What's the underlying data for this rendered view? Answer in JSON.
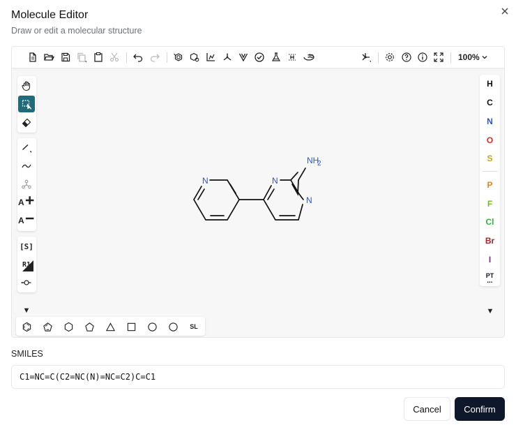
{
  "dialog": {
    "title": "Molecule Editor",
    "subtitle": "Draw or edit a molecular structure"
  },
  "toolbar": {
    "icons": [
      "new-file-icon",
      "open-folder-icon",
      "save-icon",
      "copy-icon",
      "paste-icon",
      "cut-icon",
      "undo-icon",
      "redo-icon",
      "aromatize-icon",
      "dearomatize-icon",
      "layout-icon",
      "clean-icon",
      "stereo-icon",
      "check-icon",
      "calculate-icon",
      "explicit-hydrogens-icon",
      "3d-view-icon",
      "template-icon",
      "settings-icon",
      "help-icon",
      "info-icon",
      "fullscreen-icon"
    ],
    "zoom": "100%",
    "three_d": "3D"
  },
  "left_tools": {
    "icons": [
      "hand-icon",
      "select-icon",
      "eraser-icon",
      "bond-icon",
      "chain-icon",
      "atom-icon",
      "charge-plus-icon",
      "charge-minus-icon"
    ],
    "charge_plus": "A",
    "charge_minus": "A",
    "sgroup": "[S]",
    "rgroup": "R1"
  },
  "elements": [
    {
      "symbol": "H",
      "color": "#111111"
    },
    {
      "symbol": "C",
      "color": "#111111"
    },
    {
      "symbol": "N",
      "color": "#2f55d4"
    },
    {
      "symbol": "O",
      "color": "#e0261c"
    },
    {
      "symbol": "S",
      "color": "#c9a21a"
    },
    {
      "symbol": "P",
      "color": "#f08014"
    },
    {
      "symbol": "F",
      "color": "#6cc02a"
    },
    {
      "symbol": "Cl",
      "color": "#2fb53a"
    },
    {
      "symbol": "Br",
      "color": "#a8232a"
    },
    {
      "symbol": "I",
      "color": "#8f1f9a"
    }
  ],
  "periodic_table": "PT",
  "molecule": {
    "atoms": [
      "N",
      "N",
      "N",
      "NH",
      "2"
    ]
  },
  "smiles": {
    "label": "SMILES",
    "value": "C1=NC=C(C2=NC(N)=NC=C2)C=C1"
  },
  "bottom_shapes": {
    "sl": "SL"
  },
  "buttons": {
    "cancel": "Cancel",
    "confirm": "Confirm"
  },
  "colors": {
    "accent": "#1f6b7a",
    "confirm_bg": "#0f172a",
    "nitrogen": "#2f55d4"
  }
}
